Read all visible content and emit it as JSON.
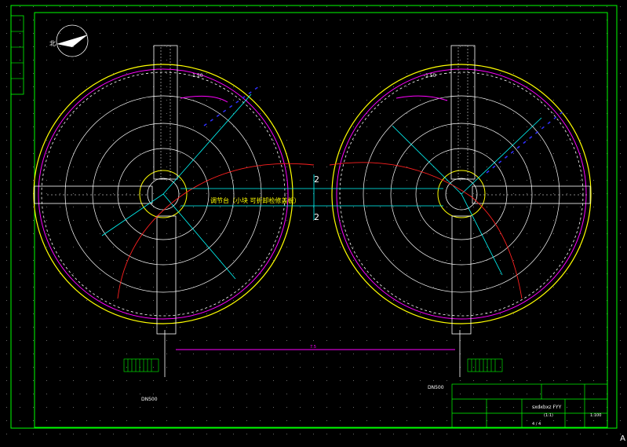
{
  "labels": {
    "walkway": "调节台（小块 可折卸检修盖板）",
    "title_block_name": "sxdxbxz FYY",
    "title_block_sub": "(1:1)",
    "title_block_scale": "1:100",
    "title_block_sheet": "4 / 4",
    "pipe_left": "DN500",
    "pipe_right": "DN500",
    "elev_left": "-1.50",
    "elev_right": "-1.50",
    "dim_mid": "7.5",
    "section_2_top": "2",
    "section_2_bot": "2",
    "corner_mark": "A"
  },
  "colors": {
    "frame": "#00ff00",
    "yellow": "#ffff00",
    "white": "#ffffff",
    "magenta": "#ff00ff",
    "red": "#ff2020",
    "cyan": "#00ffff",
    "blue": "#3030ff"
  },
  "icons": [
    "north-arrow-icon"
  ]
}
